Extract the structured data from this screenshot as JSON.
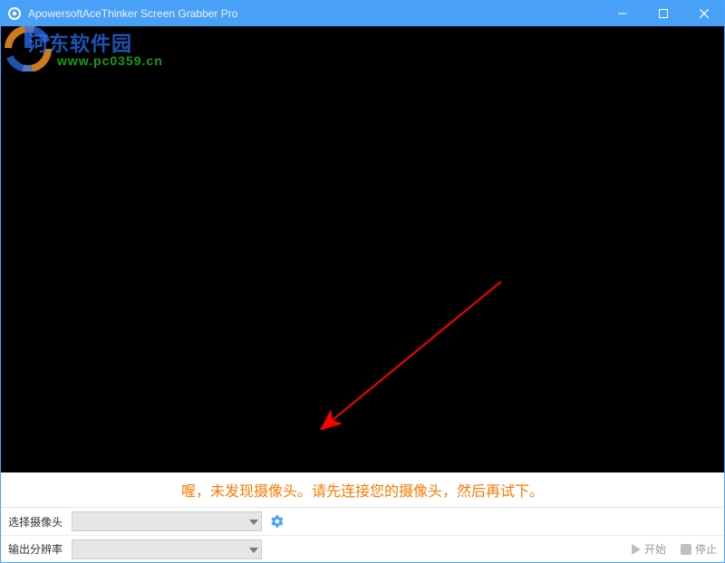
{
  "window": {
    "title": "ApowersoftAceThinker Screen Grabber Pro"
  },
  "watermark": {
    "line1": "河东软件园",
    "line2": "www.pc0359.cn"
  },
  "status": {
    "message": "喔，未发现摄像头。请先连接您的摄像头，然后再试下。"
  },
  "controls": {
    "camera_label": "选择摄像头",
    "resolution_label": "输出分辨率",
    "start_label": "开始",
    "stop_label": "停止"
  }
}
